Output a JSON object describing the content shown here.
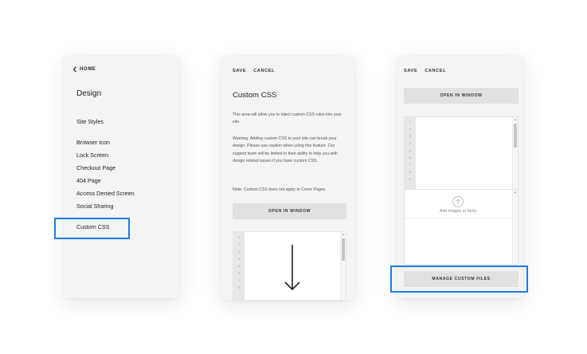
{
  "colors": {
    "highlight": "#1e7be6",
    "panel_bg": "#f4f4f4",
    "button_bg": "#e1e1e1"
  },
  "design_panel": {
    "back_icon": "chevron-left-icon",
    "back_label": "HOME",
    "title": "Design",
    "items": [
      "Site Styles",
      "Browser Icon",
      "Lock Screen",
      "Checkout Page",
      "404 Page",
      "Access Denied Screen",
      "Social Sharing",
      "Custom CSS"
    ]
  },
  "css_panel": {
    "save_label": "SAVE",
    "cancel_label": "CANCEL",
    "title": "Custom CSS",
    "intro": "This area will allow you to inject custom CSS rules into your site.",
    "warning": "Warning: Adding custom CSS to your site can break your design. Please use caution when using this feature. Our support team will be limited in their ability to help you with design related issues if you have custom CSS.",
    "note": "Note: Custom CSS does not apply to Cover Pages.",
    "open_window_label": "OPEN IN WINDOW",
    "gutter_numbers": [
      "1",
      "2",
      "3",
      "4",
      "5",
      "6",
      "7",
      "8"
    ],
    "arrow_icon": "arrow-down-icon"
  },
  "files_panel": {
    "save_label": "SAVE",
    "cancel_label": "CANCEL",
    "open_window_label": "OPEN IN WINDOW",
    "gutter_numbers": [
      "1",
      "2",
      "3",
      "4",
      "5",
      "6",
      "7",
      "8",
      "9"
    ],
    "upload_icon": "upload-arrow-icon",
    "upload_label": "Add images or fonts",
    "manage_label": "MANAGE CUSTOM FILES"
  }
}
